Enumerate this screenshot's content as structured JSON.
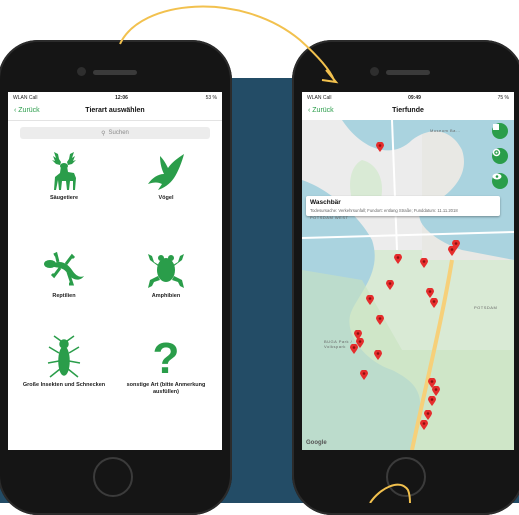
{
  "colors": {
    "accent": "#2a9d4a",
    "band": "#234c66",
    "arrow": "#f2c14e",
    "pin": "#e52d2d"
  },
  "screen1": {
    "status": {
      "carrier": "WLAN Call",
      "time": "12:06",
      "battery": "53 %"
    },
    "nav": {
      "back": "Zurück",
      "title": "Tierart auswählen"
    },
    "search": {
      "placeholder": "Suchen"
    },
    "categories": [
      {
        "icon": "deer-icon",
        "label": "Säugetiere"
      },
      {
        "icon": "bird-icon",
        "label": "Vögel"
      },
      {
        "icon": "lizard-icon",
        "label": "Reptilien"
      },
      {
        "icon": "frog-icon",
        "label": "Amphibien"
      },
      {
        "icon": "insect-icon",
        "label": "Große Insekten und Schnecken"
      },
      {
        "icon": "question-mark-icon",
        "label": "sonstige Art (bitte Anmerkung ausfüllen)"
      }
    ]
  },
  "screen2": {
    "status": {
      "carrier": "WLAN Call",
      "time": "09:49",
      "battery": "75 %"
    },
    "nav": {
      "back": "Zurück",
      "title": "Tierfunde"
    },
    "map": {
      "labels": {
        "district": "POTSDAM WEST",
        "museum": "Museum Ba...",
        "potsdam": "POTSDAM",
        "park": "BUGA Park / Volkspark"
      },
      "callout": {
        "title": "Waschbär",
        "description": "Todesursache: Verkehrsunfall; Fundort: entlang Straße; Funddatum: 11.11.2018"
      },
      "attribution": "Google",
      "buttons": [
        "list-icon",
        "locate-icon",
        "eye-icon"
      ]
    }
  }
}
